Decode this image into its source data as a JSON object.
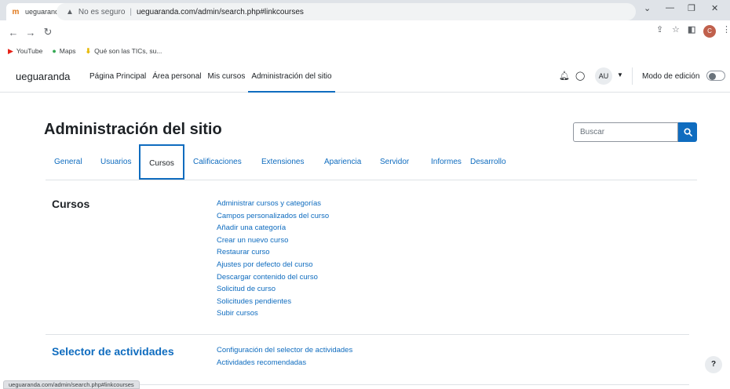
{
  "browser": {
    "tab_title": "ueguaranda: Administración: Bus",
    "tab_close": "×",
    "new_tab": "+",
    "address_warning": "No es seguro",
    "address_url": "ueguaranda.com/admin/search.php#linkcourses",
    "bookmarks": [
      {
        "label": "YouTube",
        "icon": "youtube-icon"
      },
      {
        "label": "Maps",
        "icon": "maps-pin-icon"
      },
      {
        "label": "Qué son las TICs, su...",
        "icon": "download-icon"
      }
    ],
    "profile_initial": "C",
    "status_url": "ueguaranda.com/admin/search.php#linkcourses"
  },
  "navbar": {
    "brand": "ueguaranda",
    "items": [
      {
        "label": "Página Principal"
      },
      {
        "label": "Área personal"
      },
      {
        "label": "Mis cursos"
      },
      {
        "label": "Administración del sitio"
      }
    ],
    "avatar": "AU",
    "edit_mode_label": "Modo de edición"
  },
  "page": {
    "title": "Administración del sitio",
    "search_placeholder": "Buscar",
    "tabs": [
      {
        "label": "General"
      },
      {
        "label": "Usuarios"
      },
      {
        "label": "Cursos"
      },
      {
        "label": "Calificaciones"
      },
      {
        "label": "Extensiones"
      },
      {
        "label": "Apariencia"
      },
      {
        "label": "Servidor"
      },
      {
        "label": "Informes"
      },
      {
        "label": "Desarrollo"
      }
    ],
    "sections": [
      {
        "title": "Cursos",
        "links": [
          "Administrar cursos y categorías",
          "Campos personalizados del curso",
          "Añadir una categoría",
          "Crear un nuevo curso",
          "Restaurar curso",
          "Ajustes por defecto del curso",
          "Descargar contenido del curso",
          "Solicitud de curso",
          "Solicitudes pendientes",
          "Subir cursos"
        ]
      },
      {
        "title": "Selector de actividades",
        "links": [
          "Configuración del selector de actividades",
          "Actividades recomendadas"
        ]
      }
    ],
    "help_label": "?"
  },
  "colors": {
    "accent": "#0f6cbf",
    "text": "#1d2125"
  }
}
